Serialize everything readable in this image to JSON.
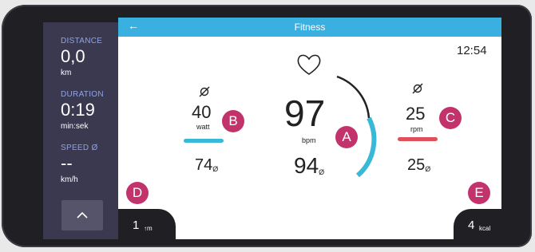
{
  "window": {
    "title": "Fitness",
    "time": "12:54"
  },
  "left_panel": {
    "distance": {
      "label": "DISTANCE",
      "value": "0,0",
      "unit": "km"
    },
    "duration": {
      "label": "DURATION",
      "value": "0:19",
      "unit": "min:sek"
    },
    "speed": {
      "label": "SPEED Ø",
      "value": "--",
      "unit": "km/h"
    }
  },
  "metrics": {
    "power": {
      "value": "40",
      "unit": "watt",
      "avg": "74",
      "avg_sub": "Ø",
      "bar_color": "#3ab8d8"
    },
    "heart": {
      "value": "97",
      "unit": "bpm",
      "avg": "94",
      "avg_sub": "Ø",
      "arc_color": "#3ab8d8"
    },
    "cadence": {
      "value": "25",
      "unit": "rpm",
      "avg": "25",
      "avg_sub": "Ø",
      "bar_color": "#e0505a"
    }
  },
  "footer": {
    "left": {
      "value": "1",
      "unit": "↑m"
    },
    "right": {
      "value": "4",
      "unit": "kcal"
    }
  },
  "badges": {
    "a": "A",
    "b": "B",
    "c": "C",
    "d": "D",
    "e": "E"
  },
  "colors": {
    "accent": "#3ab0e0",
    "badge": "#c2336b",
    "panel": "#3a3950"
  },
  "icons": [
    "back-arrow-icon",
    "heart-icon",
    "pedal-icon",
    "chevron-up-icon"
  ]
}
